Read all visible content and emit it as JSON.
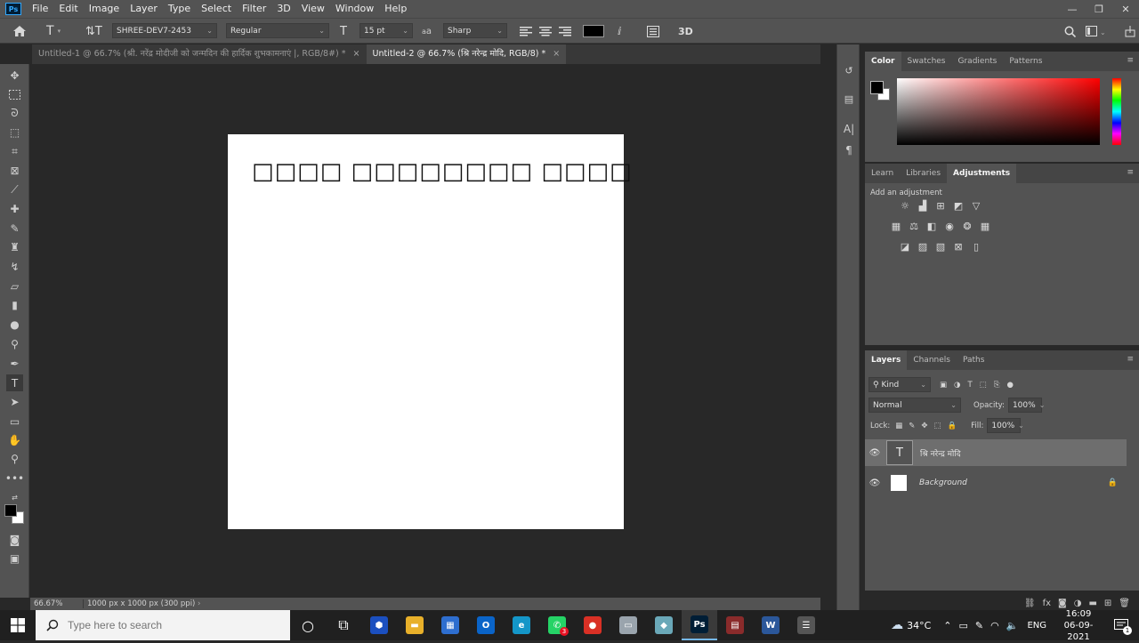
{
  "menubar": {
    "logo": "Ps",
    "items": [
      "File",
      "Edit",
      "Image",
      "Layer",
      "Type",
      "Select",
      "Filter",
      "3D",
      "View",
      "Window",
      "Help"
    ]
  },
  "options": {
    "font_family": "SHREE-DEV7-2453",
    "font_style": "Regular",
    "font_size": "15 pt",
    "aa_label": "a",
    "antialias": "Sharp",
    "three_d": "3D",
    "color_swatch": "#000000"
  },
  "tabs": [
    {
      "label": "Untitled-1 @ 66.7% (श्री. नरेंद्र मोदीजी को जन्मदिन की हार्दिक शुभकामनाएं |, RGB/8#) *",
      "close": "×"
    },
    {
      "label": "Untitled-2 @ 66.7% (श्रि नरेन्द्र मोदि, RGB/8) *",
      "close": "×"
    }
  ],
  "artboard": {
    "text": "□□□□ □□□□□□□□ □□□□"
  },
  "statusbar": {
    "zoom": "66.67%",
    "docinfo": "1000 px x 1000 px (300 ppi)",
    "chevron": "›"
  },
  "color_panel": {
    "tabs": [
      "Color",
      "Swatches",
      "Gradients",
      "Patterns"
    ],
    "menu": "≡"
  },
  "adjust_panel": {
    "tabs": [
      "Learn",
      "Libraries",
      "Adjustments"
    ],
    "title": "Add an adjustment",
    "menu": "≡"
  },
  "layers_panel": {
    "tabs": [
      "Layers",
      "Channels",
      "Paths"
    ],
    "menu": "≡",
    "filter_kind": "Kind",
    "blend_mode": "Normal",
    "opacity_label": "Opacity:",
    "opacity": "100%",
    "lock_label": "Lock:",
    "fill_label": "Fill:",
    "fill": "100%",
    "layers": [
      {
        "name": "श्रि नरेन्द्र मोदि",
        "thumb": "T"
      },
      {
        "name": "Background",
        "thumb": ""
      }
    ]
  },
  "taskbar": {
    "search_placeholder": "Type here to search",
    "weather": "34°C",
    "lang": "ENG",
    "time": "16:09",
    "date": "06-09-2021",
    "whatsapp_badge": "3",
    "notif_badge": "1",
    "apps": [
      {
        "name": "cortana-icon",
        "glyph": "○"
      },
      {
        "name": "task-view-icon",
        "glyph": "⧉"
      },
      {
        "name": "app-icon-blue",
        "glyph": "⬢",
        "bg": "#1b4fbf"
      },
      {
        "name": "file-explorer-icon",
        "glyph": "▬",
        "bg": "#e8b02a"
      },
      {
        "name": "calculator-icon",
        "glyph": "▦",
        "bg": "#2e6ecf"
      },
      {
        "name": "outlook-icon",
        "glyph": "O",
        "bg": "#0a64c8"
      },
      {
        "name": "edge-icon",
        "glyph": "e",
        "bg": "#1496c8"
      },
      {
        "name": "whatsapp-icon",
        "glyph": "✆",
        "bg": "#25d366"
      },
      {
        "name": "chrome-icon",
        "glyph": "●",
        "bg": "#d93025"
      },
      {
        "name": "app-icon-white",
        "glyph": "▭",
        "bg": "#9aa4ad"
      },
      {
        "name": "app-icon-teal",
        "glyph": "◆",
        "bg": "#6aa8b8"
      },
      {
        "name": "photoshop-icon",
        "glyph": "Ps",
        "bg": "#001e36",
        "active": true
      },
      {
        "name": "winrar-icon",
        "glyph": "▤",
        "bg": "#8a2b2b"
      },
      {
        "name": "word-icon",
        "glyph": "W",
        "bg": "#2b579a"
      },
      {
        "name": "app-icon-gray",
        "glyph": "☰",
        "bg": "#555555"
      }
    ]
  }
}
